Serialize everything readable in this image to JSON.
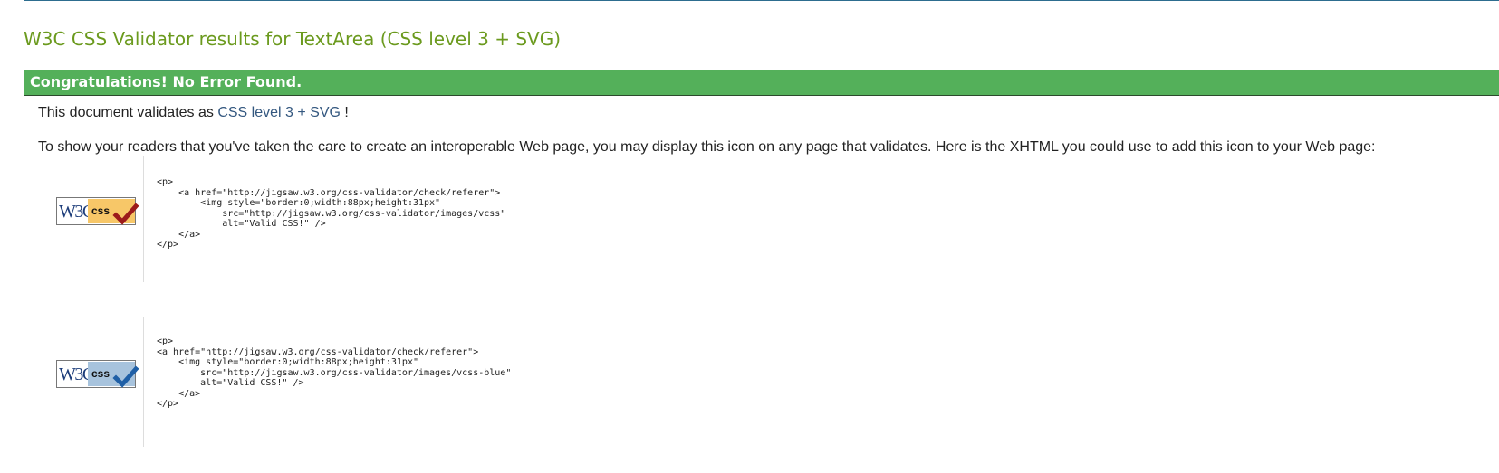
{
  "page_title": "W3C CSS Validator results for TextArea (CSS level 3 + SVG)",
  "congrats": "Congratulations! No Error Found.",
  "validates": {
    "prefix": "This document validates as",
    "link_text": "CSS level 3 + SVG",
    "suffix": "!"
  },
  "readers_text": "To show your readers that you've taken the care to create an interoperable Web page, you may display this icon on any page that validates. Here is the XHTML you could use to add this icon to your Web page:",
  "badges": [
    {
      "w3c_text": "W3C",
      "css_text": "css",
      "icon": "valid-css-gold-badge-icon",
      "bg_color": "#f7c768",
      "check_color": "#9c1a1a",
      "code": "<p>\n    <a href=\"http://jigsaw.w3.org/css-validator/check/referer\">\n        <img style=\"border:0;width:88px;height:31px\"\n            src=\"http://jigsaw.w3.org/css-validator/images/vcss\"\n            alt=\"Valid CSS!\" />\n    </a>\n</p>"
    },
    {
      "w3c_text": "W3C",
      "css_text": "css",
      "icon": "valid-css-blue-badge-icon",
      "bg_color": "#a7c3dd",
      "check_color": "#1f5fa6",
      "code": "<p>\n<a href=\"http://jigsaw.w3.org/css-validator/check/referer\">\n    <img style=\"border:0;width:88px;height:31px\"\n        src=\"http://jigsaw.w3.org/css-validator/images/vcss-blue\"\n        alt=\"Valid CSS!\" />\n    </a>\n</p>"
    }
  ],
  "colors": {
    "title": "#6b9a1e",
    "congrats_bar": "#54b05a",
    "link": "#33577f"
  }
}
